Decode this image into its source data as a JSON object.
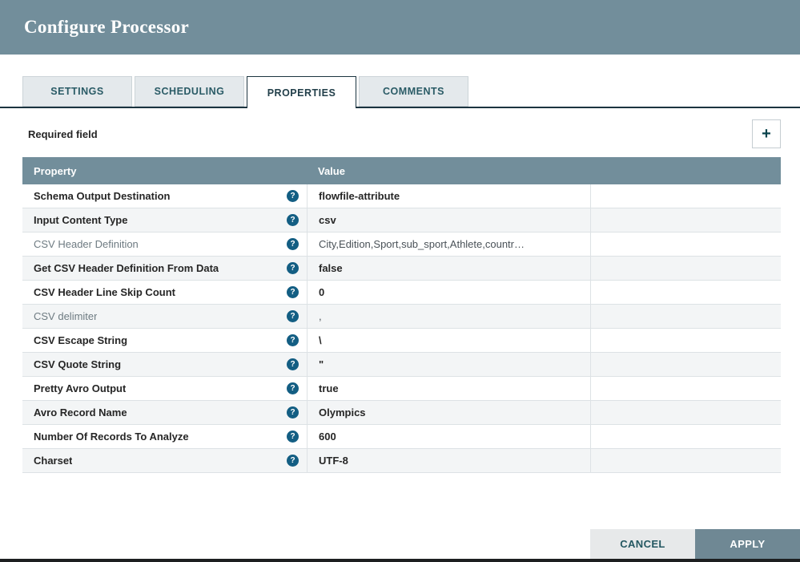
{
  "dialog": {
    "title": "Configure Processor"
  },
  "tabs": [
    {
      "label": "SETTINGS",
      "active": false
    },
    {
      "label": "SCHEDULING",
      "active": false
    },
    {
      "label": "PROPERTIES",
      "active": true
    },
    {
      "label": "COMMENTS",
      "active": false
    }
  ],
  "toolbar": {
    "required_label": "Required field"
  },
  "icons": {
    "add": "+",
    "help": "?"
  },
  "table": {
    "header": {
      "property": "Property",
      "value": "Value"
    },
    "rows": [
      {
        "property": "Schema Output Destination",
        "value": "flowfile-attribute",
        "muted": false,
        "value_bold": true
      },
      {
        "property": "Input Content Type",
        "value": "csv",
        "muted": false,
        "value_bold": true
      },
      {
        "property": "CSV Header Definition",
        "value": "City,Edition,Sport,sub_sport,Athlete,countr…",
        "muted": true,
        "value_bold": false
      },
      {
        "property": "Get CSV Header Definition From Data",
        "value": "false",
        "muted": false,
        "value_bold": true
      },
      {
        "property": "CSV Header Line Skip Count",
        "value": "0",
        "muted": false,
        "value_bold": true
      },
      {
        "property": "CSV delimiter",
        "value": ",",
        "muted": true,
        "value_bold": false
      },
      {
        "property": "CSV Escape String",
        "value": "\\",
        "muted": false,
        "value_bold": true
      },
      {
        "property": "CSV Quote String",
        "value": "\"",
        "muted": false,
        "value_bold": true
      },
      {
        "property": "Pretty Avro Output",
        "value": "true",
        "muted": false,
        "value_bold": true
      },
      {
        "property": "Avro Record Name",
        "value": "Olympics",
        "muted": false,
        "value_bold": true
      },
      {
        "property": "Number Of Records To Analyze",
        "value": "600",
        "muted": false,
        "value_bold": true
      },
      {
        "property": "Charset",
        "value": "UTF-8",
        "muted": false,
        "value_bold": true
      }
    ]
  },
  "footer": {
    "cancel_label": "CANCEL",
    "apply_label": "APPLY"
  },
  "colors": {
    "header_bg": "#728e9b",
    "accent_dark": "#1b3440",
    "help_icon": "#135e83",
    "apply_bg": "#6f8894",
    "row_alt_bg": "#f3f5f6"
  }
}
